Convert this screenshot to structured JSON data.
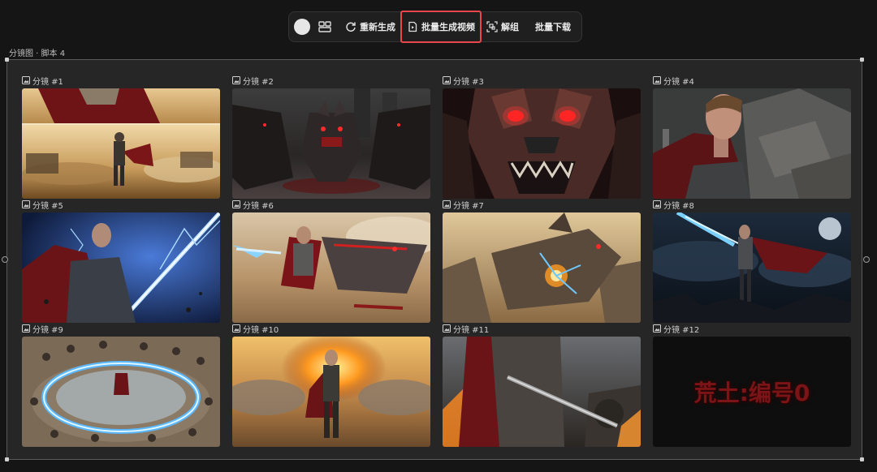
{
  "toolbar": {
    "regenerate_label": "重新生成",
    "batch_video_label": "批量生成视频",
    "ungroup_label": "解组",
    "batch_download_label": "批量下载",
    "highlight_color": "#e8484b"
  },
  "canvas": {
    "group_label": "分镜图 · 脚本 4"
  },
  "shots": [
    {
      "label": "分镜 #1"
    },
    {
      "label": "分镜 #2"
    },
    {
      "label": "分镜 #3"
    },
    {
      "label": "分镜 #4"
    },
    {
      "label": "分镜 #5"
    },
    {
      "label": "分镜 #6"
    },
    {
      "label": "分镜 #7"
    },
    {
      "label": "分镜 #8"
    },
    {
      "label": "分镜 #9"
    },
    {
      "label": "分镜 #10"
    },
    {
      "label": "分镜 #11"
    },
    {
      "label": "分镜 #12",
      "title_text": "荒土:编号0"
    }
  ],
  "icons": {
    "color_swatch": "color-circle-icon",
    "layout": "layout-grid-icon",
    "regenerate": "refresh-icon",
    "batch_video": "video-edit-icon",
    "ungroup": "ungroup-icon",
    "shot": "image-icon"
  }
}
